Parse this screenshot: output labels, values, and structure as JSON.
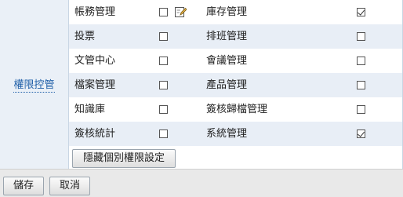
{
  "section_label": "權限控管",
  "rows": [
    {
      "left": {
        "label": "帳務管理",
        "checked": false,
        "has_edit_icon": true
      },
      "right": {
        "label": "庫存管理",
        "checked": true
      }
    },
    {
      "left": {
        "label": "投票",
        "checked": false
      },
      "right": {
        "label": "排班管理",
        "checked": false
      }
    },
    {
      "left": {
        "label": "文管中心",
        "checked": false
      },
      "right": {
        "label": "會議管理",
        "checked": false
      }
    },
    {
      "left": {
        "label": "檔案管理",
        "checked": false
      },
      "right": {
        "label": "產品管理",
        "checked": false
      }
    },
    {
      "left": {
        "label": "知識庫",
        "checked": false
      },
      "right": {
        "label": "簽核歸檔管理",
        "checked": false
      }
    },
    {
      "left": {
        "label": "簽核統計",
        "checked": false
      },
      "right": {
        "label": "系統管理",
        "checked": true
      }
    }
  ],
  "toggle_button": "隱藏個別權限設定",
  "footer": {
    "save": "儲存",
    "cancel": "取消"
  },
  "icons": {
    "edit": "edit-pencil-icon"
  }
}
